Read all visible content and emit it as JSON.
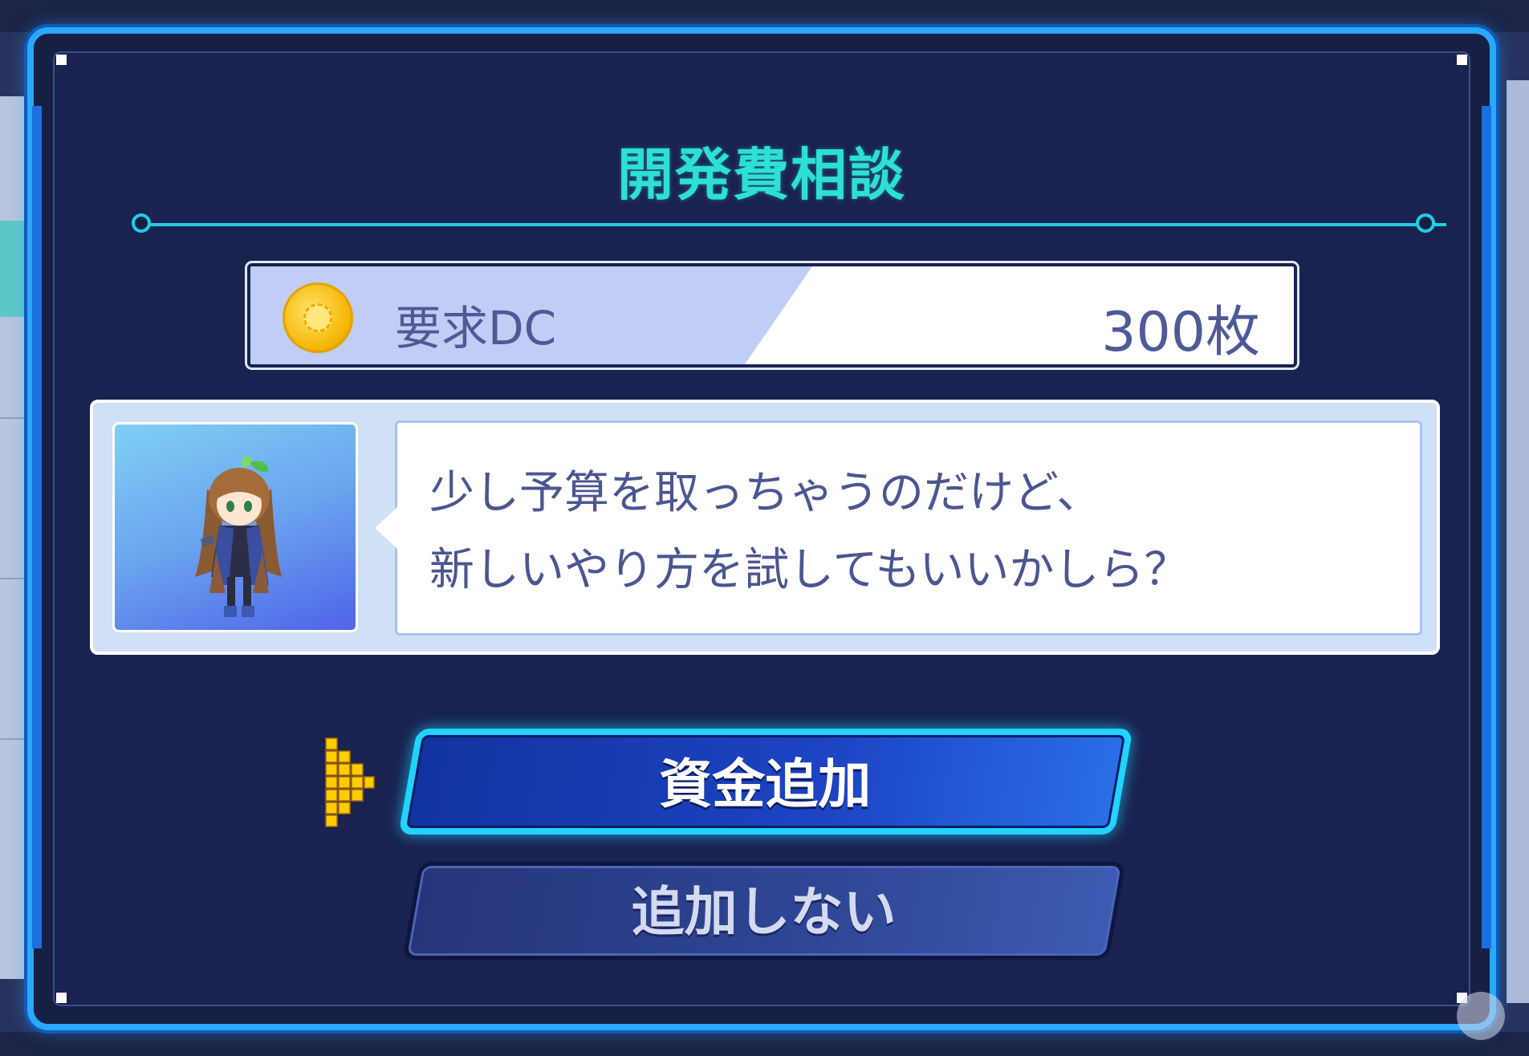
{
  "dialog": {
    "title": "開発費相談",
    "cost": {
      "icon": "gear-coin-icon",
      "label": "要求DC",
      "value": "300枚"
    },
    "speaker_portrait": "chibi-girl-portrait",
    "message_lines": [
      "少し予算を取っちゃうのだけど、",
      "新しいやり方を試してもいいかしら？"
    ],
    "buttons": {
      "confirm_label": "資金追加",
      "decline_label": "追加しない"
    },
    "selection_cursor": "pixel-arrow-cursor-icon"
  },
  "colors": {
    "frame": "#2aa8ff",
    "title": "#2de0d6",
    "panel": "#171f45",
    "cursor": "#ffcc00"
  }
}
